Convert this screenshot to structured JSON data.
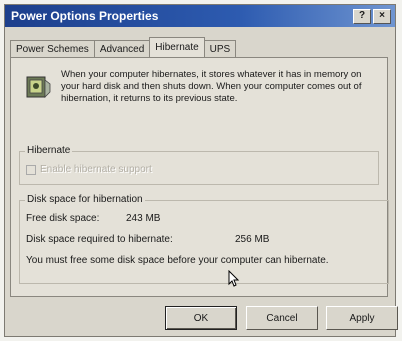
{
  "window": {
    "title": "Power Options Properties",
    "help_glyph": "?",
    "close_glyph": "×"
  },
  "tabs": [
    {
      "label": "Power Schemes",
      "active": false
    },
    {
      "label": "Advanced",
      "active": false
    },
    {
      "label": "Hibernate",
      "active": true
    },
    {
      "label": "UPS",
      "active": false
    }
  ],
  "info": {
    "icon": "hibernate-icon",
    "text": "When your computer hibernates, it stores whatever it has in memory on your hard disk and then shuts down. When your computer comes out of hibernation, it returns to its previous state."
  },
  "hibernate_group": {
    "label": "Hibernate",
    "checkbox_label": "Enable hibernate support",
    "checked": false,
    "enabled": false
  },
  "disk_group": {
    "label": "Disk space for hibernation",
    "free_label": "Free disk space:",
    "free_value": "243 MB",
    "required_label": "Disk space required to hibernate:",
    "required_value": "256 MB",
    "message": "You must free some disk space before your computer can hibernate."
  },
  "buttons": {
    "ok": "OK",
    "cancel": "Cancel",
    "apply": "Apply"
  }
}
